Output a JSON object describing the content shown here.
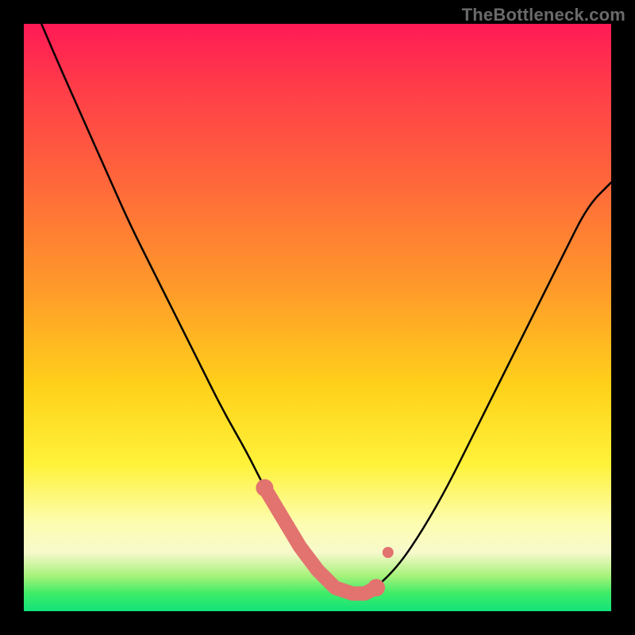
{
  "watermark": "TheBottleneck.com",
  "chart_data": {
    "type": "line",
    "title": "",
    "xlabel": "",
    "ylabel": "",
    "xlim": [
      0,
      100
    ],
    "ylim": [
      0,
      100
    ],
    "grid": false,
    "series": [
      {
        "name": "bottleneck-curve",
        "color": "#000000",
        "x": [
          3,
          6,
          10,
          14,
          18,
          22,
          26,
          30,
          34,
          38,
          41,
          44,
          47,
          50,
          53,
          56,
          58,
          60,
          64,
          68,
          72,
          76,
          80,
          84,
          88,
          92,
          96,
          100
        ],
        "y": [
          100,
          93,
          84,
          75,
          66,
          58,
          50,
          42,
          34,
          27,
          21,
          16,
          11,
          7,
          4,
          3,
          3,
          4,
          8,
          14,
          21,
          29,
          37,
          45,
          53,
          61,
          69,
          73
        ]
      },
      {
        "name": "optimal-zone-markers",
        "color": "#e2736f",
        "type": "marker-band",
        "x": [
          41,
          44,
          47,
          50,
          53,
          56,
          58,
          60
        ],
        "y": [
          21,
          16,
          11,
          7,
          4,
          3,
          3,
          4
        ]
      }
    ],
    "colors": {
      "background_gradient_top": "#ff1a55",
      "background_gradient_mid": "#fff23a",
      "background_gradient_bottom": "#12e27a",
      "curve": "#000000",
      "marker": "#e2736f",
      "frame": "#000000"
    }
  }
}
